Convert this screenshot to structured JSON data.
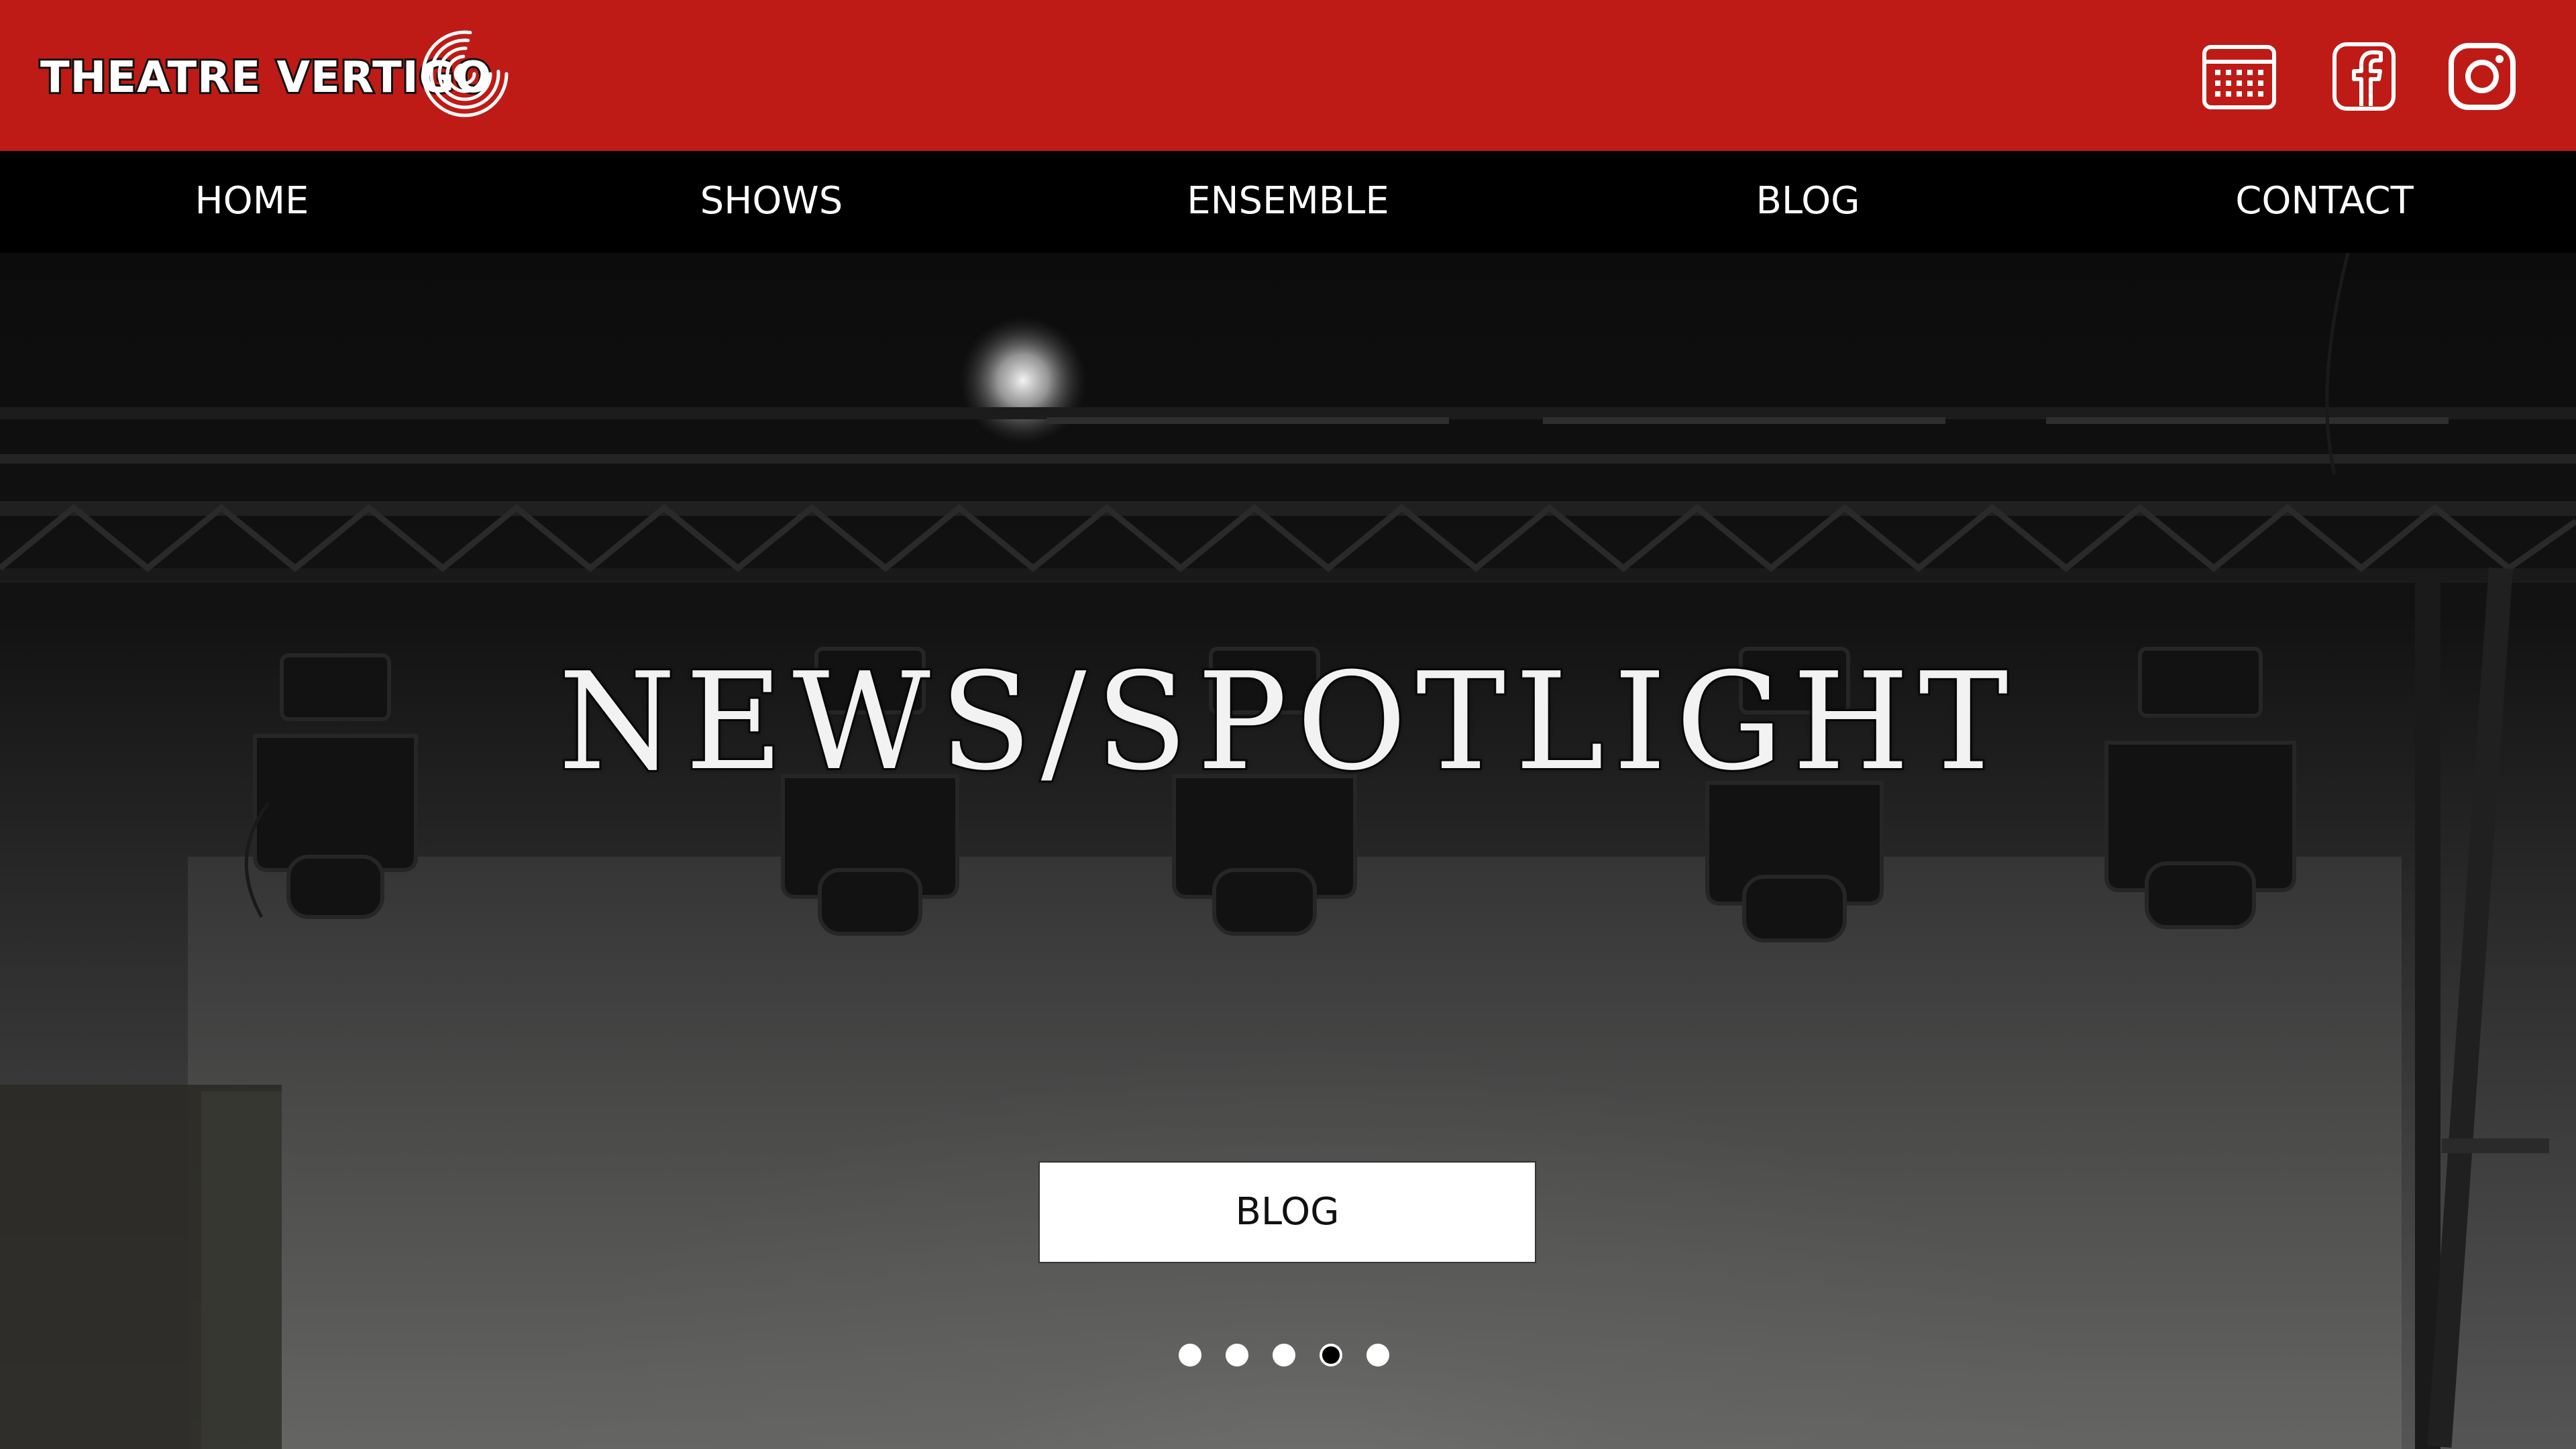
{
  "header": {
    "logo_text": "THEATRE VERTIGO",
    "social": [
      {
        "icon": "calendar-icon"
      },
      {
        "icon": "facebook-icon"
      },
      {
        "icon": "instagram-icon"
      }
    ]
  },
  "nav": {
    "items": [
      {
        "label": "HOME",
        "active": true
      },
      {
        "label": "SHOWS",
        "active": false
      },
      {
        "label": "ENSEMBLE",
        "active": false
      },
      {
        "label": "BLOG",
        "active": false
      },
      {
        "label": "CONTACT",
        "active": false
      }
    ]
  },
  "hero": {
    "title": "NEWS/SPOTLIGHT",
    "button_label": "BLOG",
    "slide_count": 5,
    "active_slide": 4
  },
  "colors": {
    "brand_red": "#be1b16",
    "nav_background": "#000000",
    "button_background": "#ffffff"
  }
}
